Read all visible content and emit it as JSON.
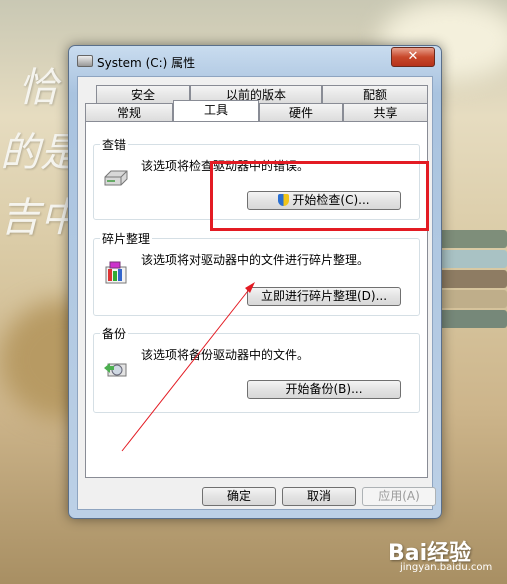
{
  "window": {
    "title": "System (C:) 属性",
    "close_label": "✕"
  },
  "tabs_row1": [
    "安全",
    "以前的版本",
    "配额"
  ],
  "tabs_row2": [
    "常规",
    "工具",
    "硬件",
    "共享"
  ],
  "active_tab": "工具",
  "groups": {
    "error_check": {
      "title": "查错",
      "desc": "该选项将检查驱动器中的错误。",
      "button": "开始检查(C)..."
    },
    "defrag": {
      "title": "碎片整理",
      "desc": "该选项将对驱动器中的文件进行碎片整理。",
      "button": "立即进行碎片整理(D)..."
    },
    "backup": {
      "title": "备份",
      "desc": "该选项将备份驱动器中的文件。",
      "button": "开始备份(B)..."
    }
  },
  "footer": {
    "ok": "确定",
    "cancel": "取消",
    "apply": "应用(A)"
  },
  "background": {
    "text": [
      "恰",
      "的是",
      "吉中"
    ],
    "watermark": "Bai经验",
    "watermark_url": "jingyan.baidu.com"
  },
  "colors": {
    "highlight_box": "#e31b23"
  }
}
